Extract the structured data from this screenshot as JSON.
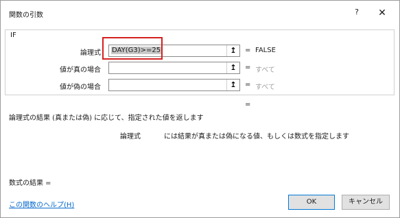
{
  "dialog": {
    "title": "関数の引数",
    "help_label": "?",
    "close_label": "✕"
  },
  "function": {
    "name": "IF",
    "args": [
      {
        "label": "論理式",
        "value_selected": "DAY(G3)>=25",
        "result": "FALSE"
      },
      {
        "label": "値が真の場合",
        "value": "",
        "result": "すべて"
      },
      {
        "label": "値が偽の場合",
        "value": "",
        "result": "すべて"
      }
    ],
    "eq_sign": "=",
    "overall_eq": "="
  },
  "description": {
    "main": "論理式の結果 (真または偽) に応じて、指定された値を返します",
    "arg_name": "論理式",
    "arg_desc": "には結果が真または偽になる値、もしくは数式を指定します"
  },
  "result": {
    "label": "数式の結果 ="
  },
  "footer": {
    "help_link": "この関数のヘルプ(H)",
    "ok_label": "OK",
    "cancel_label": "キャンセル"
  },
  "icons": {
    "ref_glyph": "↥"
  },
  "colors": {
    "highlight": "#d42020",
    "link": "#0066cc",
    "placeholder": "#a0a0a0"
  }
}
